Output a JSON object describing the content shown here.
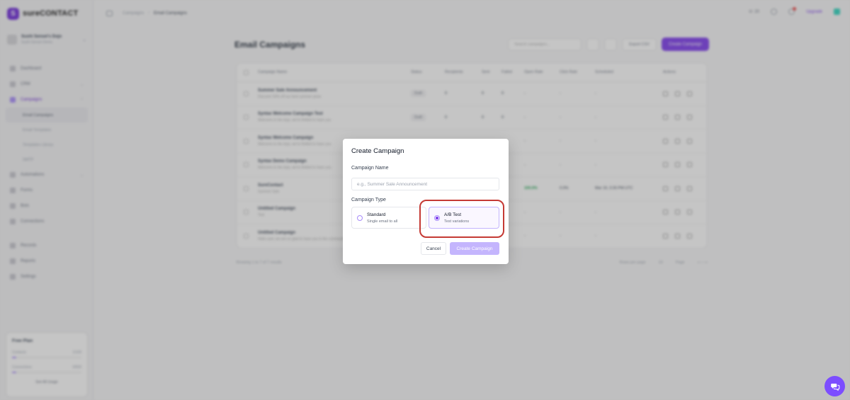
{
  "app": {
    "brand": "sureCONTACT",
    "brand_initial": "S"
  },
  "workspace": {
    "name": "Sushi Sensei's Dojo",
    "sub": "Sushi Sensei Demo"
  },
  "sidebar": {
    "items": [
      {
        "label": "Dashboard"
      },
      {
        "label": "CRM"
      },
      {
        "label": "Campaigns"
      },
      {
        "label": "Automations"
      },
      {
        "label": "Forms"
      },
      {
        "label": "Bots"
      },
      {
        "label": "Connections"
      },
      {
        "label": "Records"
      },
      {
        "label": "Reports"
      },
      {
        "label": "Settings"
      }
    ],
    "sub_items": [
      {
        "label": "Email Campaigns"
      },
      {
        "label": "Email Templates"
      },
      {
        "label": "Templates Library"
      },
      {
        "label": "SMTP"
      }
    ]
  },
  "plan": {
    "title": "Free Plan",
    "rows": [
      {
        "label": "Contacts",
        "value": "1/100"
      },
      {
        "label": "Connections",
        "value": "0/500"
      }
    ],
    "button": "See All Usage"
  },
  "topbar": {
    "crumbs": [
      "Campaigns",
      "Email Campaigns"
    ],
    "credits": "20",
    "upgrade": "Upgrade"
  },
  "main": {
    "title": "Email Campaigns",
    "search_placeholder": "Search campaigns...",
    "export": "Export CSV",
    "create": "Create Campaign"
  },
  "table": {
    "headers": [
      "Campaign Name",
      "Status",
      "Recipients",
      "Sent",
      "Failed",
      "Open Rate",
      "Click Rate",
      "Scheduled",
      "Actions"
    ],
    "rows": [
      {
        "name": "Summer Sale Announcement",
        "sub": "Discover 50% off our best summer picks",
        "status": "Draft",
        "recipients": "0",
        "sent": "0",
        "failed": "0",
        "open": "-",
        "click": "-",
        "sched": "-"
      },
      {
        "name": "Syntax Welcome Campaign Test",
        "sub": "Welcome to the dojo, we're thrilled to have you",
        "status": "Draft",
        "recipients": "0",
        "sent": "0",
        "failed": "0",
        "open": "-",
        "click": "-",
        "sched": "-"
      },
      {
        "name": "Syntax Welcome Campaign",
        "sub": "Welcome to the dojo, we're thrilled to have you",
        "status": "",
        "recipients": "",
        "sent": "",
        "failed": "",
        "open": "-",
        "click": "-",
        "sched": "-"
      },
      {
        "name": "Syntax Demo Campaign",
        "sub": "Welcome to the dojo, we're thrilled to have you",
        "status": "",
        "recipients": "",
        "sent": "",
        "failed": "",
        "open": "-",
        "click": "-",
        "sched": "-"
      },
      {
        "name": "SureContact",
        "sub": "Summer Sale",
        "status": "",
        "recipients": "",
        "sent": "",
        "failed": "",
        "open": "100.0%",
        "click": "0.0%",
        "sched": "Mar 19, 3:26 PM UTC"
      },
      {
        "name": "Untitled Campaign",
        "sub": "Test",
        "status": "",
        "recipients": "",
        "sent": "",
        "failed": "",
        "open": "-",
        "click": "-",
        "sched": "-"
      },
      {
        "name": "Untitled Campaign",
        "sub": "Hello user, we are so glad to have you in the community",
        "status": "",
        "recipients": "",
        "sent": "",
        "failed": "",
        "open": "-",
        "click": "-",
        "sched": "-"
      }
    ]
  },
  "footer": {
    "showing": "Showing 1 to 7 of 7 results",
    "rows_per_page": "Rows per page",
    "rows_value": "10",
    "page": "Page"
  },
  "modal": {
    "title": "Create Campaign",
    "name_label": "Campaign Name",
    "name_placeholder": "e.g., Summer Sale Announcement",
    "type_label": "Campaign Type",
    "options": [
      {
        "title": "Standard",
        "subtitle": "Single email to all",
        "selected": false
      },
      {
        "title": "A/B Test",
        "subtitle": "Test variations",
        "selected": true
      }
    ],
    "cancel": "Cancel",
    "create": "Create Campaign"
  },
  "colors": {
    "accent": "#7c3aed",
    "accent_light": "#c4b5fd",
    "highlight": "#c53a34",
    "success": "#16a34a"
  },
  "icons": [
    "sidebar-toggle-icon",
    "phone-icon",
    "help-icon",
    "bell-icon",
    "chat-bubble-icon",
    "chevron-down-icon",
    "search-icon",
    "filter-icon",
    "refresh-icon",
    "edit-icon",
    "duplicate-icon",
    "delete-icon"
  ]
}
